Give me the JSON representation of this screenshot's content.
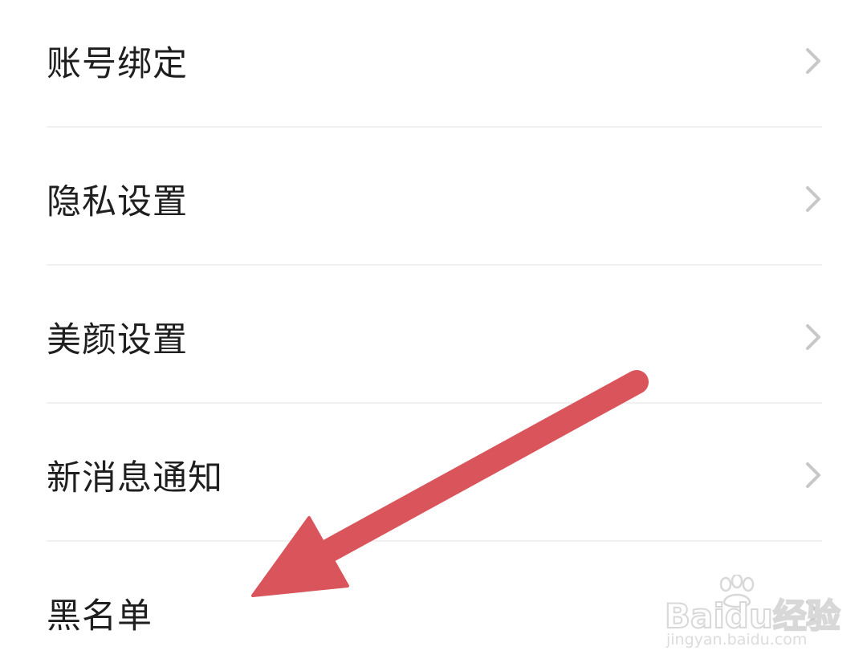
{
  "settings": {
    "items": [
      {
        "label": "账号绑定",
        "icon": "chevron-right-icon"
      },
      {
        "label": "隐私设置",
        "icon": "chevron-right-icon"
      },
      {
        "label": "美颜设置",
        "icon": "chevron-right-icon"
      },
      {
        "label": "新消息通知",
        "icon": "chevron-right-icon"
      },
      {
        "label": "黑名单",
        "icon": "chevron-right-icon"
      }
    ]
  },
  "annotation": {
    "arrow_color": "#d9545b",
    "points_to": "黑名单"
  },
  "watermark": {
    "brand": "Baidu经验",
    "url": "jingyan.baidu.com"
  },
  "colors": {
    "background": "#ffffff",
    "text": "#1f1f1f",
    "chevron": "#c8c8c8",
    "divider": "#f1f1f1"
  }
}
